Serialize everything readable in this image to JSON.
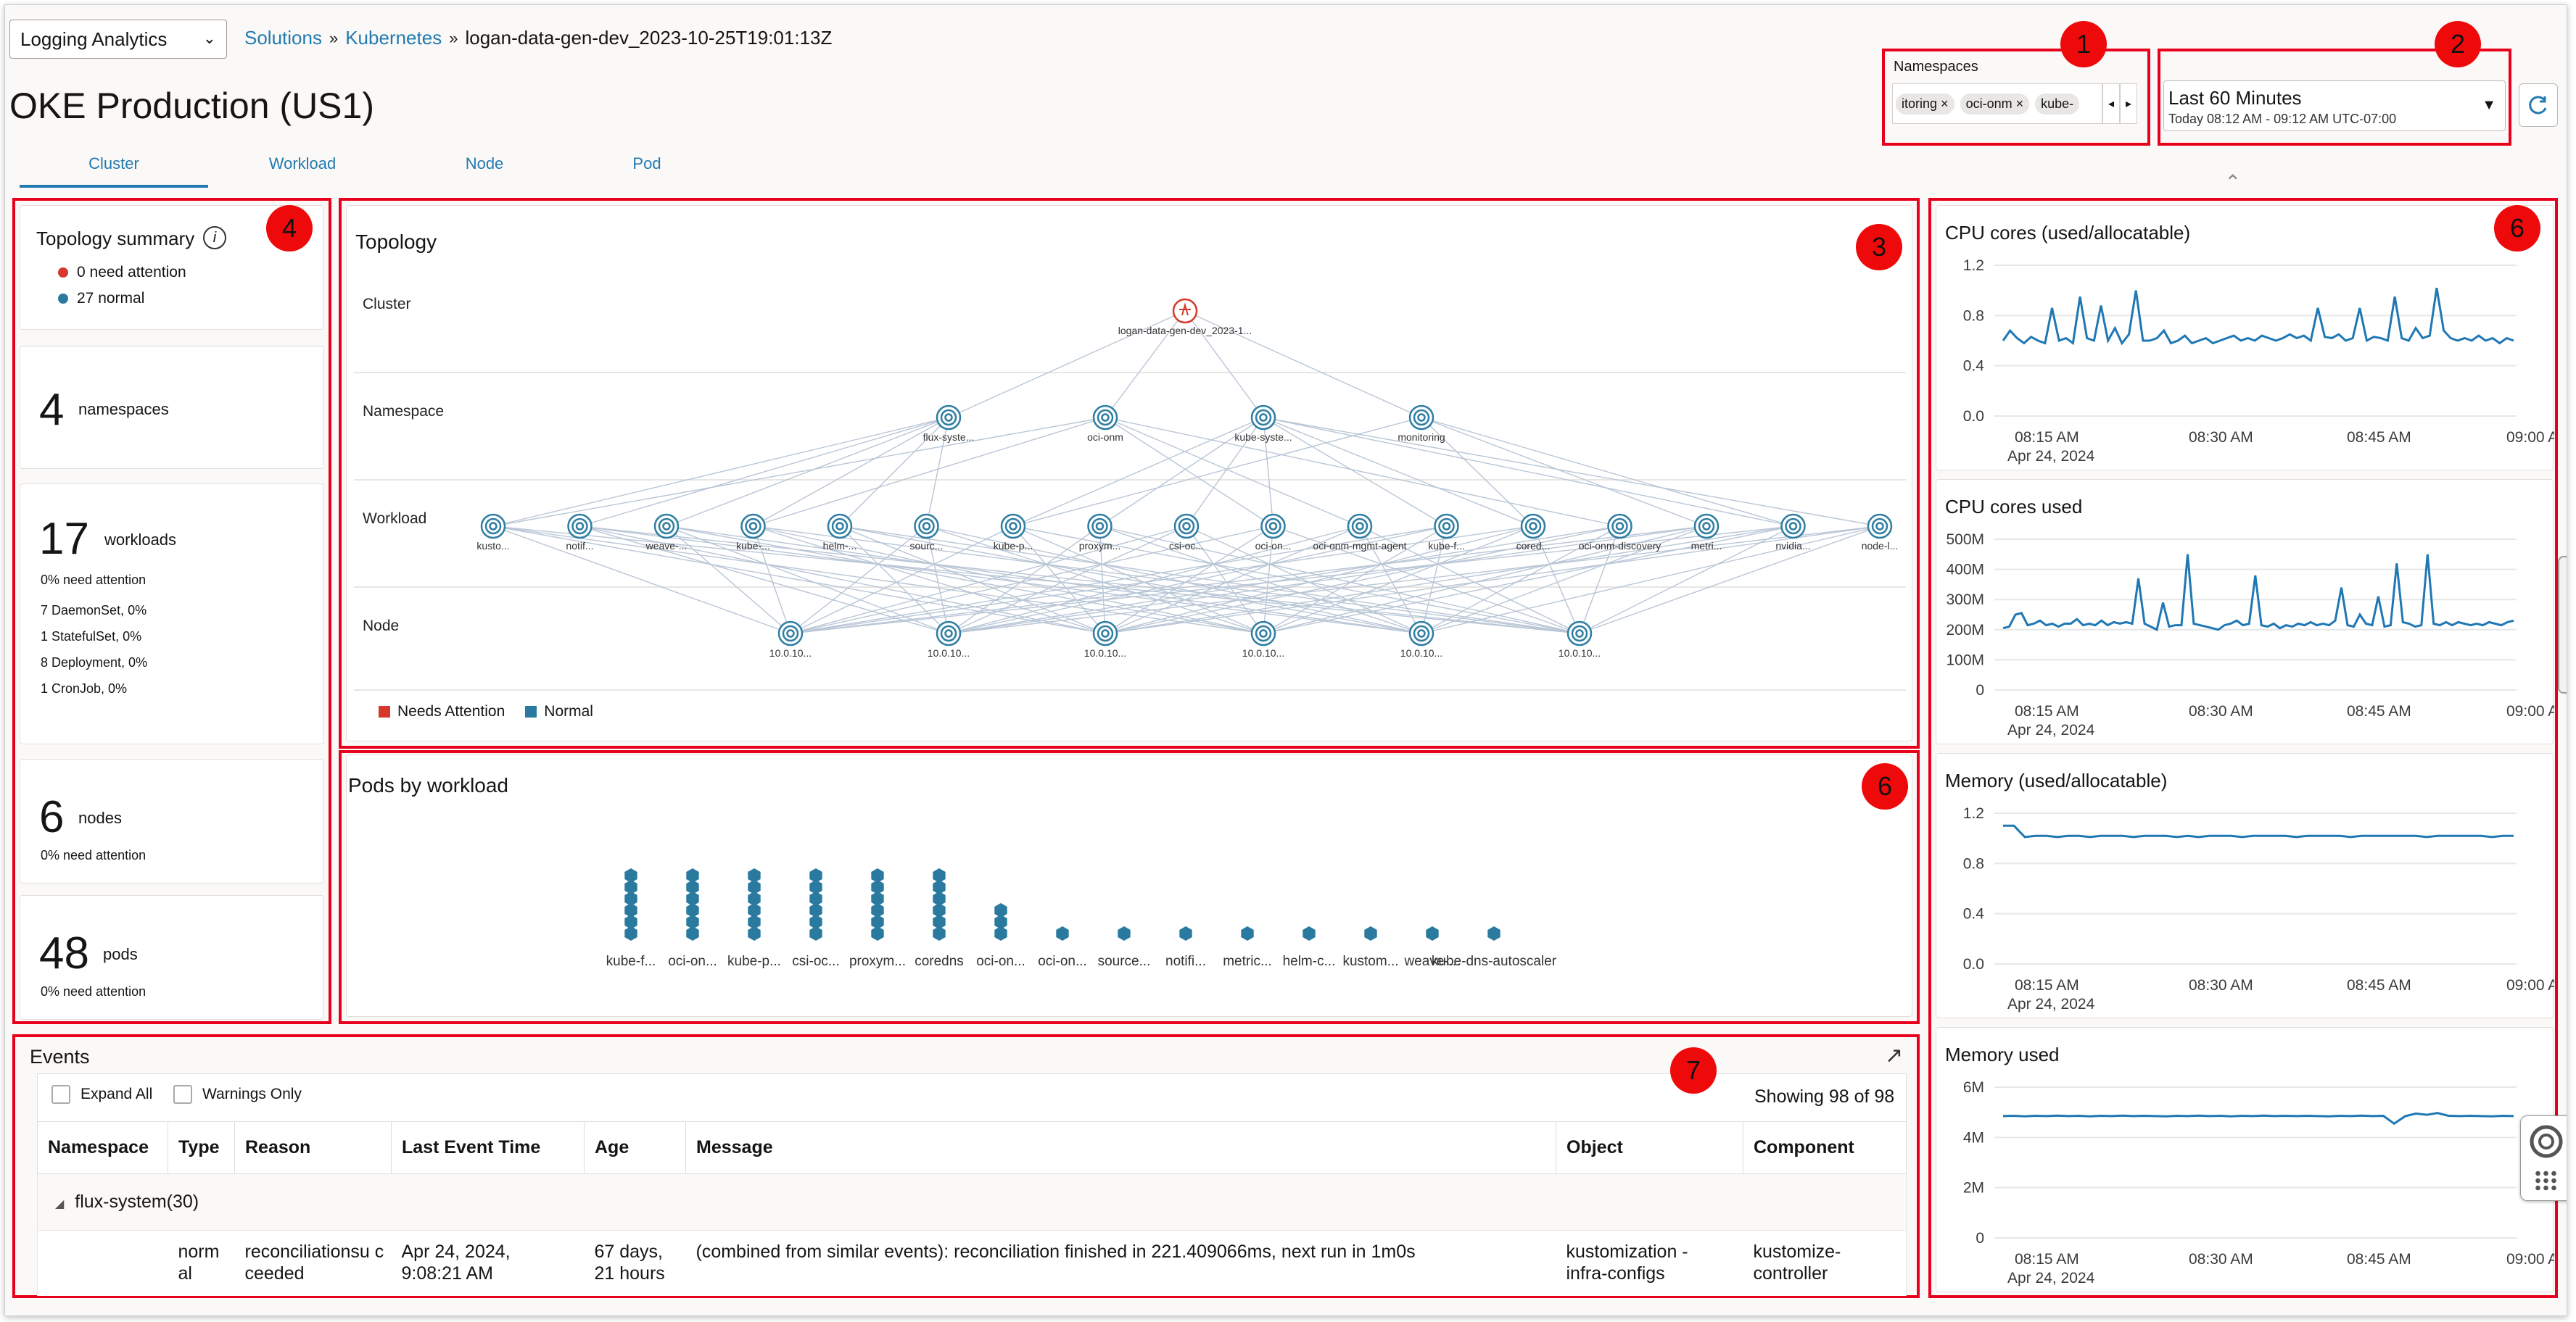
{
  "header": {
    "app_selector": "Logging Analytics",
    "breadcrumb": [
      "Solutions",
      "Kubernetes"
    ],
    "breadcrumb_sep": "»",
    "breadcrumb_current": "logan-data-gen-dev_2023-10-25T19:01:13Z",
    "page_title": "OKE Production (US1)",
    "tabs": [
      {
        "label": "Cluster",
        "active": true
      },
      {
        "label": "Workload"
      },
      {
        "label": "Node"
      },
      {
        "label": "Pod"
      }
    ]
  },
  "namespaces": {
    "label": "Namespaces",
    "chips": [
      "itoring",
      "oci-onm",
      "kube-"
    ]
  },
  "time_range": {
    "label": "Last 60 Minutes",
    "detail": "Today 08:12 AM - 09:12 AM UTC-07:00"
  },
  "callouts": [
    "1",
    "2",
    "3",
    "4",
    "6",
    "6",
    "7"
  ],
  "summary": {
    "title": "Topology summary",
    "attention": "0 need attention",
    "normal": "27 normal",
    "namespaces": {
      "count": "4",
      "label": "namespaces"
    },
    "workloads": {
      "count": "17",
      "label": "workloads",
      "attention": "0% need attention",
      "details": [
        "7 DaemonSet, 0%",
        "1 StatefulSet, 0%",
        "8 Deployment, 0%",
        "1 CronJob, 0%"
      ]
    },
    "nodes": {
      "count": "6",
      "label": "nodes",
      "attention": "0% need attention"
    },
    "pods": {
      "count": "48",
      "label": "pods",
      "attention": "0% need attention"
    }
  },
  "topology": {
    "title": "Topology",
    "rows": [
      "Cluster",
      "Namespace",
      "Workload",
      "Node"
    ],
    "cluster": "logan-data-gen-dev_2023-1...",
    "namespaces": [
      "flux-syste...",
      "oci-onm",
      "kube-syste...",
      "monitoring"
    ],
    "workloads": [
      "kusto...",
      "notif...",
      "weave-...",
      "kube-...",
      "helm-...",
      "sourc...",
      "kube-p...",
      "proxym...",
      "csi-oc...",
      "oci-on...",
      "oci-onm-mgmt-agent",
      "kube-f...",
      "cored...",
      "oci-onm-discovery",
      "metri...",
      "nvidia...",
      "node-l..."
    ],
    "nodes": [
      "10.0.10...",
      "10.0.10...",
      "10.0.10...",
      "10.0.10...",
      "10.0.10...",
      "10.0.10..."
    ],
    "legend": [
      {
        "label": "Needs Attention",
        "color": "#d6392b"
      },
      {
        "label": "Normal",
        "color": "#2a7aa0"
      }
    ]
  },
  "pods_by_workload": {
    "title": "Pods by workload",
    "labels": [
      "kube-f...",
      "oci-on...",
      "kube-p...",
      "csi-oc...",
      "proxym...",
      "coredns",
      "oci-on...",
      "oci-on...",
      "source...",
      "notifi...",
      "metric...",
      "helm-c...",
      "kustom...",
      "weave-...",
      "kube-dns-autoscaler"
    ],
    "counts": [
      6,
      6,
      6,
      6,
      6,
      6,
      3,
      1,
      1,
      1,
      1,
      1,
      1,
      1,
      1
    ],
    "color": "#2a7aa0"
  },
  "chart_data": [
    {
      "type": "line",
      "title": "CPU cores (used/allocatable)",
      "ylim": [
        0,
        1.2
      ],
      "yticks": [
        "1.2",
        "0.8",
        "0.4",
        "0.0"
      ],
      "xticks": [
        "08:15 AM",
        "08:30 AM",
        "08:45 AM",
        "09:00 AM"
      ],
      "xdate": "Apr 24, 2024",
      "y": [
        0.6,
        0.68,
        0.62,
        0.58,
        0.63,
        0.6,
        0.58,
        0.86,
        0.6,
        0.62,
        0.58,
        0.95,
        0.62,
        0.6,
        0.88,
        0.6,
        0.7,
        0.58,
        0.65,
        1.0,
        0.6,
        0.6,
        0.62,
        0.68,
        0.58,
        0.6,
        0.64,
        0.58,
        0.6,
        0.62,
        0.58,
        0.6,
        0.62,
        0.64,
        0.6,
        0.62,
        0.6,
        0.64,
        0.62,
        0.6,
        0.62,
        0.65,
        0.62,
        0.64,
        0.6,
        0.86,
        0.63,
        0.62,
        0.65,
        0.6,
        0.62,
        0.86,
        0.6,
        0.63,
        0.62,
        0.6,
        0.95,
        0.62,
        0.6,
        0.7,
        0.62,
        0.64,
        1.02,
        0.68,
        0.62,
        0.6,
        0.62,
        0.6,
        0.64,
        0.6,
        0.62,
        0.58,
        0.62,
        0.6
      ]
    },
    {
      "type": "line",
      "title": "CPU cores used",
      "ylim": [
        0,
        500
      ],
      "yticks": [
        "500M",
        "400M",
        "300M",
        "200M",
        "100M",
        "0"
      ],
      "xticks": [
        "08:15 AM",
        "08:30 AM",
        "08:45 AM",
        "09:00 AM"
      ],
      "xdate": "Apr 24, 2024",
      "y": [
        205,
        210,
        250,
        255,
        215,
        220,
        230,
        215,
        220,
        210,
        220,
        220,
        235,
        215,
        220,
        215,
        230,
        215,
        225,
        220,
        225,
        220,
        370,
        220,
        210,
        200,
        290,
        210,
        215,
        215,
        450,
        220,
        215,
        210,
        205,
        200,
        215,
        220,
        230,
        215,
        220,
        380,
        215,
        210,
        220,
        205,
        215,
        210,
        220,
        215,
        225,
        215,
        220,
        215,
        230,
        340,
        215,
        210,
        250,
        220,
        215,
        310,
        210,
        215,
        420,
        225,
        220,
        210,
        215,
        450,
        220,
        215,
        225,
        215,
        225,
        220,
        215,
        220,
        215,
        225,
        220,
        215,
        225,
        230
      ]
    },
    {
      "type": "line",
      "title": "Memory (used/allocatable)",
      "ylim": [
        0,
        1.2
      ],
      "yticks": [
        "1.2",
        "0.8",
        "0.4",
        "0.0"
      ],
      "xticks": [
        "08:15 AM",
        "08:30 AM",
        "08:45 AM",
        "09:00 AM"
      ],
      "xdate": "Apr 24, 2024",
      "y": [
        1.1,
        1.1,
        1.01,
        1.02,
        1.02,
        1.01,
        1.02,
        1.02,
        1.01,
        1.02,
        1.02,
        1.02,
        1.01,
        1.02,
        1.02,
        1.02,
        1.01,
        1.02,
        1.01,
        1.02,
        1.02,
        1.02,
        1.01,
        1.02,
        1.02,
        1.02,
        1.02,
        1.01,
        1.02,
        1.02,
        1.02,
        1.02,
        1.01,
        1.02,
        1.02,
        1.02,
        1.02,
        1.02,
        1.02,
        1.01,
        1.02,
        1.02,
        1.02,
        1.02,
        1.02,
        1.01,
        1.02,
        1.02
      ]
    },
    {
      "type": "line",
      "title": "Memory used",
      "ylim": [
        0,
        6
      ],
      "yticks": [
        "6M",
        "4M",
        "2M",
        "0"
      ],
      "xticks": [
        "08:15 AM",
        "08:30 AM",
        "08:45 AM",
        "09:00 AM"
      ],
      "xdate": "Apr 24, 2024",
      "y": [
        4.85,
        4.86,
        4.84,
        4.86,
        4.85,
        4.87,
        4.85,
        4.86,
        4.84,
        4.86,
        4.85,
        4.87,
        4.85,
        4.86,
        4.85,
        4.84,
        4.86,
        4.85,
        4.87,
        4.85,
        4.86,
        4.84,
        4.86,
        4.85,
        4.87,
        4.85,
        4.86,
        4.85,
        4.86,
        4.85,
        4.84,
        4.86,
        4.85,
        4.87,
        4.85,
        4.86,
        4.55,
        4.84,
        4.95,
        4.9,
        4.97,
        4.86,
        4.85,
        4.86,
        4.85,
        4.84,
        4.86,
        4.85
      ]
    }
  ],
  "events": {
    "title": "Events",
    "expand_all": "Expand All",
    "warnings_only": "Warnings Only",
    "showing": "Showing 98 of 98",
    "columns": [
      "Namespace",
      "Type",
      "Reason",
      "Last Event Time",
      "Age",
      "Message",
      "Object",
      "Component"
    ],
    "group": "flux-system(30)",
    "row": {
      "type": "norm al",
      "reason": "reconciliationsu cceeded",
      "time": "Apr 24, 2024, 9:08:21 AM",
      "age": "67 days, 21 hours",
      "message": "(combined from similar events): reconciliation finished in 221.409066ms, next run in 1m0s",
      "object": "kustomization - infra-configs",
      "component": "kustomize-controller"
    }
  }
}
